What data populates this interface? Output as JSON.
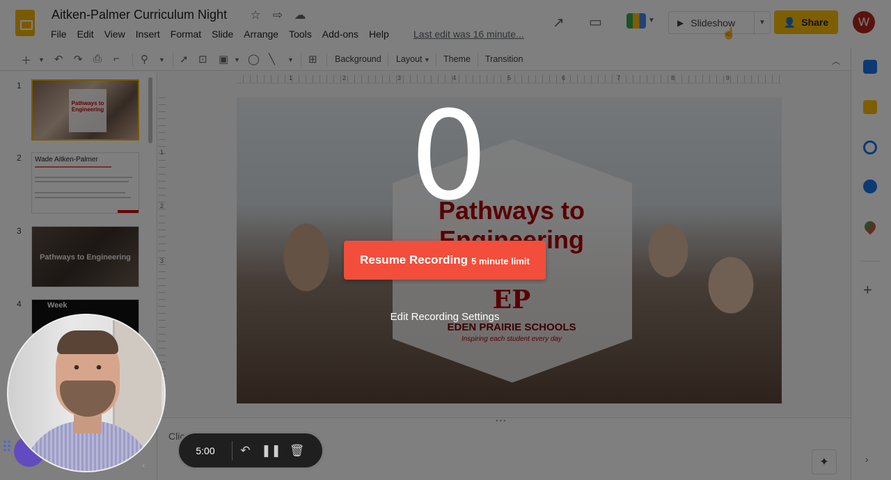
{
  "app": {
    "doc_title": "Aitken-Palmer Curriculum Night",
    "menus": [
      "File",
      "Edit",
      "View",
      "Insert",
      "Format",
      "Slide",
      "Arrange",
      "Tools",
      "Add-ons",
      "Help"
    ],
    "last_edit": "Last edit was 16 minute..."
  },
  "header_actions": {
    "slideshow_label": "Slideshow",
    "share_label": "Share",
    "account_initial": "W"
  },
  "toolbar": {
    "background_label": "Background",
    "layout_label": "Layout",
    "theme_label": "Theme",
    "transition_label": "Transition"
  },
  "filmstrip": {
    "slides": [
      {
        "num": "1",
        "text": "Pathways to Engineering"
      },
      {
        "num": "2",
        "title": "Wade Aitken-Palmer"
      },
      {
        "num": "3",
        "text": "Pathways to Engineering"
      },
      {
        "num": "4",
        "text": "Week"
      }
    ]
  },
  "ruler": {
    "h_marks": [
      "1",
      "2",
      "3",
      "4",
      "5",
      "6",
      "7",
      "8",
      "9"
    ],
    "v_marks": [
      "1",
      "2",
      "3"
    ]
  },
  "slide": {
    "title": "Pathways to Engineering",
    "logo": "EP",
    "school": "EDEN PRAIRIE SCHOOLS",
    "tagline": "Inspiring each student every day"
  },
  "notes": {
    "text": "Clic"
  },
  "recording": {
    "countdown": "0",
    "resume_label": "Resume Recording",
    "resume_limit": "5 minute limit",
    "edit_settings": "Edit Recording Settings",
    "timer": "5:00"
  },
  "colors": {
    "share": "#fbbc04",
    "resume": "#f24e3b",
    "avatar": "#b3261e",
    "slides_brand": "#f4b400",
    "slide_title": "#b00000"
  },
  "icons": {
    "star": "star-icon",
    "move": "folder-move-icon",
    "cloud": "cloud-status-icon",
    "trend": "activity-trend-icon",
    "comment": "comment-icon",
    "meet": "google-meet-icon",
    "undo": "undo-icon",
    "pause": "pause-icon",
    "trash": "trash-icon"
  }
}
